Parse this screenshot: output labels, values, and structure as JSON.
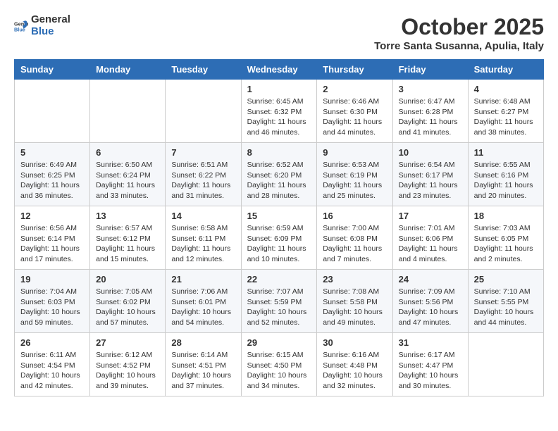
{
  "header": {
    "logo_general": "General",
    "logo_blue": "Blue",
    "month": "October 2025",
    "location": "Torre Santa Susanna, Apulia, Italy"
  },
  "weekdays": [
    "Sunday",
    "Monday",
    "Tuesday",
    "Wednesday",
    "Thursday",
    "Friday",
    "Saturday"
  ],
  "weeks": [
    [
      {
        "day": "",
        "info": ""
      },
      {
        "day": "",
        "info": ""
      },
      {
        "day": "",
        "info": ""
      },
      {
        "day": "1",
        "info": "Sunrise: 6:45 AM\nSunset: 6:32 PM\nDaylight: 11 hours and 46 minutes."
      },
      {
        "day": "2",
        "info": "Sunrise: 6:46 AM\nSunset: 6:30 PM\nDaylight: 11 hours and 44 minutes."
      },
      {
        "day": "3",
        "info": "Sunrise: 6:47 AM\nSunset: 6:28 PM\nDaylight: 11 hours and 41 minutes."
      },
      {
        "day": "4",
        "info": "Sunrise: 6:48 AM\nSunset: 6:27 PM\nDaylight: 11 hours and 38 minutes."
      }
    ],
    [
      {
        "day": "5",
        "info": "Sunrise: 6:49 AM\nSunset: 6:25 PM\nDaylight: 11 hours and 36 minutes."
      },
      {
        "day": "6",
        "info": "Sunrise: 6:50 AM\nSunset: 6:24 PM\nDaylight: 11 hours and 33 minutes."
      },
      {
        "day": "7",
        "info": "Sunrise: 6:51 AM\nSunset: 6:22 PM\nDaylight: 11 hours and 31 minutes."
      },
      {
        "day": "8",
        "info": "Sunrise: 6:52 AM\nSunset: 6:20 PM\nDaylight: 11 hours and 28 minutes."
      },
      {
        "day": "9",
        "info": "Sunrise: 6:53 AM\nSunset: 6:19 PM\nDaylight: 11 hours and 25 minutes."
      },
      {
        "day": "10",
        "info": "Sunrise: 6:54 AM\nSunset: 6:17 PM\nDaylight: 11 hours and 23 minutes."
      },
      {
        "day": "11",
        "info": "Sunrise: 6:55 AM\nSunset: 6:16 PM\nDaylight: 11 hours and 20 minutes."
      }
    ],
    [
      {
        "day": "12",
        "info": "Sunrise: 6:56 AM\nSunset: 6:14 PM\nDaylight: 11 hours and 17 minutes."
      },
      {
        "day": "13",
        "info": "Sunrise: 6:57 AM\nSunset: 6:12 PM\nDaylight: 11 hours and 15 minutes."
      },
      {
        "day": "14",
        "info": "Sunrise: 6:58 AM\nSunset: 6:11 PM\nDaylight: 11 hours and 12 minutes."
      },
      {
        "day": "15",
        "info": "Sunrise: 6:59 AM\nSunset: 6:09 PM\nDaylight: 11 hours and 10 minutes."
      },
      {
        "day": "16",
        "info": "Sunrise: 7:00 AM\nSunset: 6:08 PM\nDaylight: 11 hours and 7 minutes."
      },
      {
        "day": "17",
        "info": "Sunrise: 7:01 AM\nSunset: 6:06 PM\nDaylight: 11 hours and 4 minutes."
      },
      {
        "day": "18",
        "info": "Sunrise: 7:03 AM\nSunset: 6:05 PM\nDaylight: 11 hours and 2 minutes."
      }
    ],
    [
      {
        "day": "19",
        "info": "Sunrise: 7:04 AM\nSunset: 6:03 PM\nDaylight: 10 hours and 59 minutes."
      },
      {
        "day": "20",
        "info": "Sunrise: 7:05 AM\nSunset: 6:02 PM\nDaylight: 10 hours and 57 minutes."
      },
      {
        "day": "21",
        "info": "Sunrise: 7:06 AM\nSunset: 6:01 PM\nDaylight: 10 hours and 54 minutes."
      },
      {
        "day": "22",
        "info": "Sunrise: 7:07 AM\nSunset: 5:59 PM\nDaylight: 10 hours and 52 minutes."
      },
      {
        "day": "23",
        "info": "Sunrise: 7:08 AM\nSunset: 5:58 PM\nDaylight: 10 hours and 49 minutes."
      },
      {
        "day": "24",
        "info": "Sunrise: 7:09 AM\nSunset: 5:56 PM\nDaylight: 10 hours and 47 minutes."
      },
      {
        "day": "25",
        "info": "Sunrise: 7:10 AM\nSunset: 5:55 PM\nDaylight: 10 hours and 44 minutes."
      }
    ],
    [
      {
        "day": "26",
        "info": "Sunrise: 6:11 AM\nSunset: 4:54 PM\nDaylight: 10 hours and 42 minutes."
      },
      {
        "day": "27",
        "info": "Sunrise: 6:12 AM\nSunset: 4:52 PM\nDaylight: 10 hours and 39 minutes."
      },
      {
        "day": "28",
        "info": "Sunrise: 6:14 AM\nSunset: 4:51 PM\nDaylight: 10 hours and 37 minutes."
      },
      {
        "day": "29",
        "info": "Sunrise: 6:15 AM\nSunset: 4:50 PM\nDaylight: 10 hours and 34 minutes."
      },
      {
        "day": "30",
        "info": "Sunrise: 6:16 AM\nSunset: 4:48 PM\nDaylight: 10 hours and 32 minutes."
      },
      {
        "day": "31",
        "info": "Sunrise: 6:17 AM\nSunset: 4:47 PM\nDaylight: 10 hours and 30 minutes."
      },
      {
        "day": "",
        "info": ""
      }
    ]
  ]
}
